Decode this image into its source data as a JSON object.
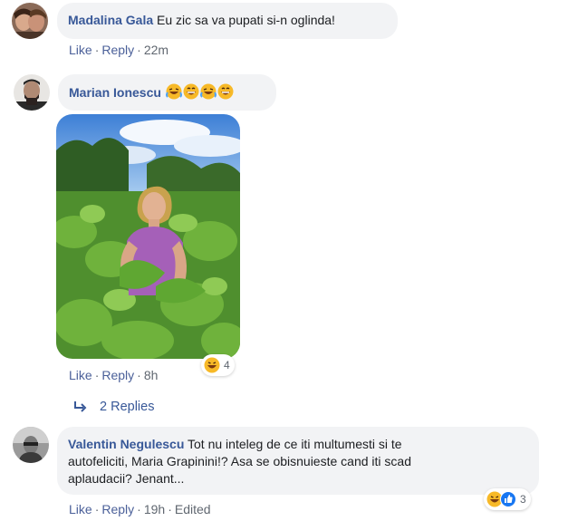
{
  "comments": [
    {
      "author": "Madalina Gala",
      "text": "Eu zic sa va pupati si-n oglinda!",
      "actions": {
        "like": "Like",
        "reply": "Reply",
        "time": "22m"
      }
    },
    {
      "author": "Marian Ionescu",
      "emojis": [
        "laughing-tears-emoji",
        "grinning-emoji",
        "laughing-tears-emoji",
        "grinning-emoji"
      ],
      "actions": {
        "like": "Like",
        "reply": "Reply",
        "time": "8h"
      },
      "reactions": {
        "icons": [
          "haha-reaction-icon"
        ],
        "count": "4"
      },
      "replies_label": "2 Replies"
    },
    {
      "author": "Valentin Negulescu",
      "text_lines": [
        "Tot nu inteleg de ce iti multumesti si te",
        "autofeliciti, Maria Grapinini!? Asa se obisnuieste cand iti scad",
        "aplaudacii? Jenant..."
      ],
      "actions": {
        "like": "Like",
        "reply": "Reply",
        "time": "19h",
        "edited": "Edited"
      },
      "reactions": {
        "icons": [
          "haha-reaction-icon",
          "like-reaction-icon"
        ],
        "count": "3"
      }
    }
  ],
  "colors": {
    "author": "#385898",
    "action": "#4b6099",
    "bubble": "#f2f3f5",
    "meta": "#606770"
  }
}
